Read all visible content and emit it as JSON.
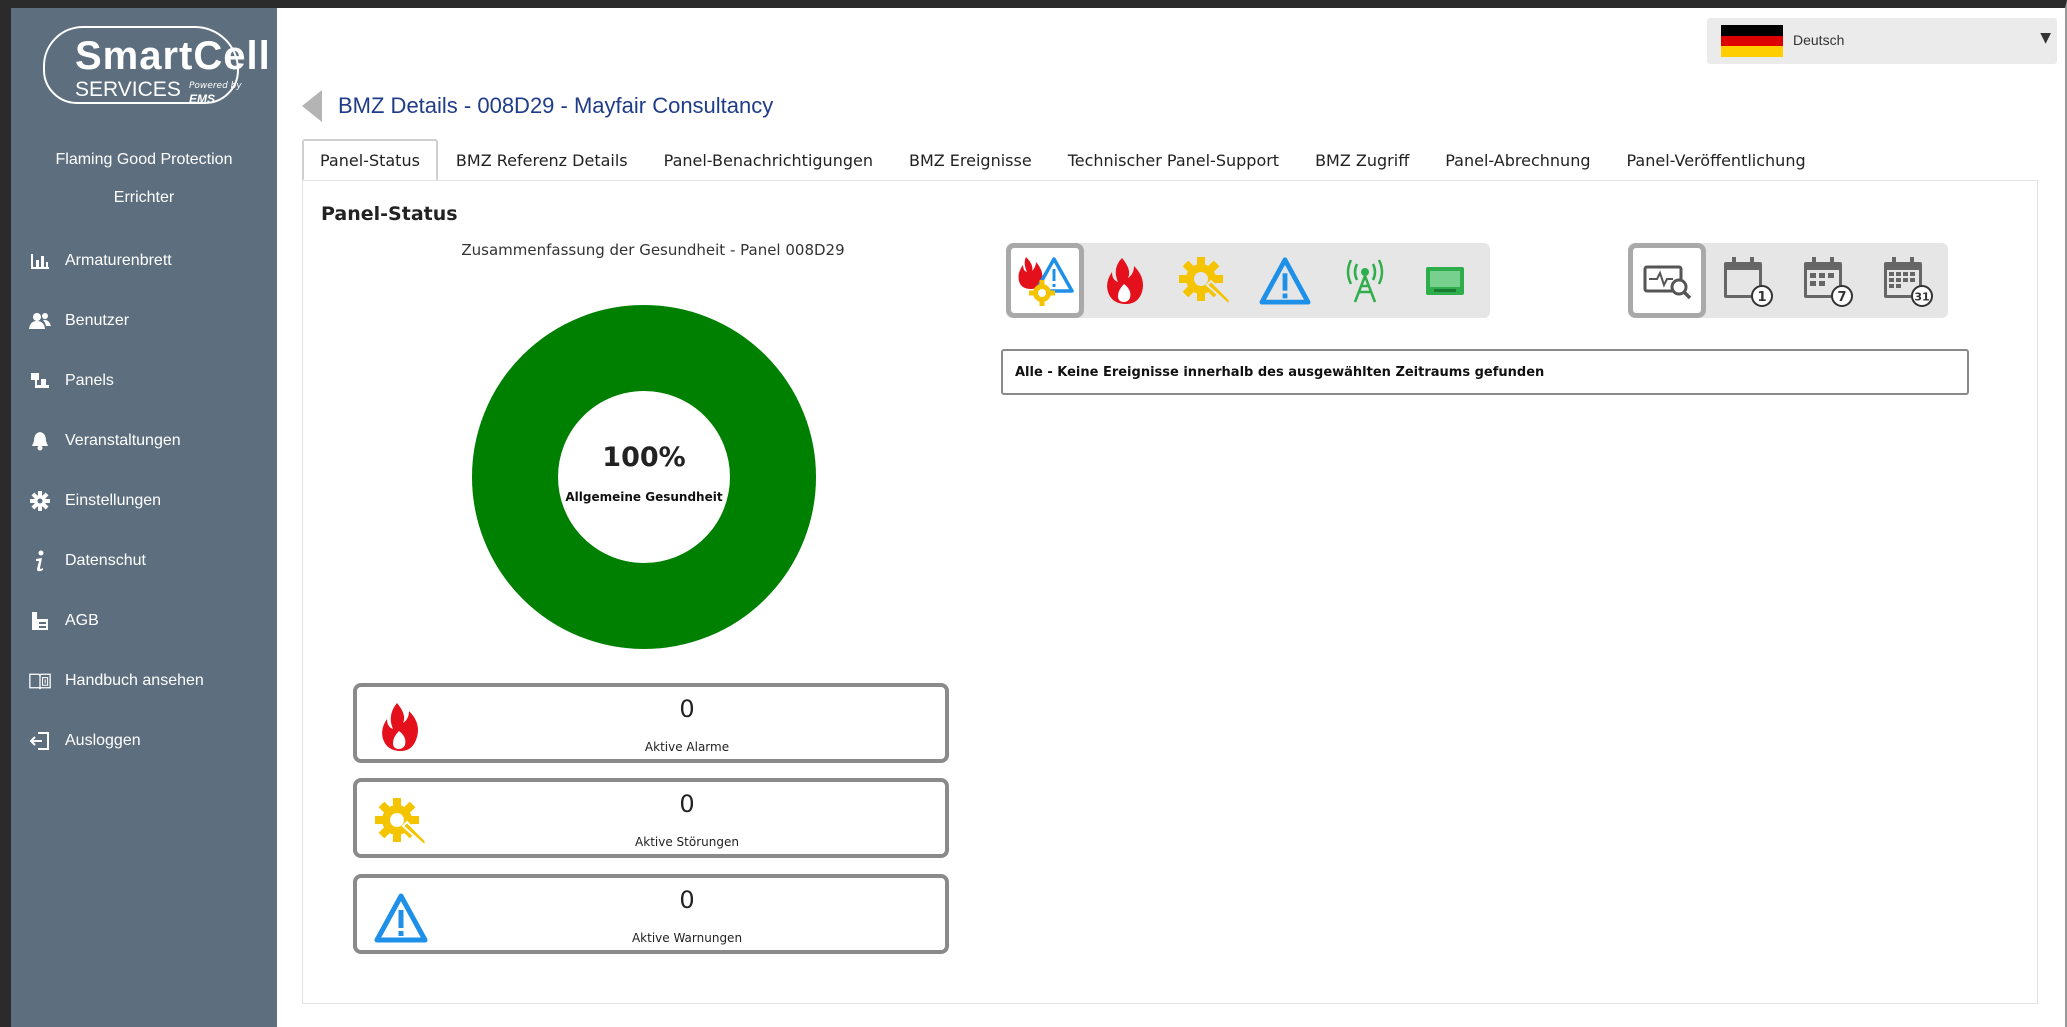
{
  "brand": {
    "logo_smart": "SmartCell",
    "logo_services": "SERVICES",
    "logo_powered": "Powered by",
    "logo_ems": "EMS"
  },
  "sidebar": {
    "company": "Flaming Good Protection",
    "role": "Errichter",
    "items": [
      {
        "label": "Armaturenbrett",
        "icon": "bar-chart-icon"
      },
      {
        "label": "Benutzer",
        "icon": "users-icon"
      },
      {
        "label": "Panels",
        "icon": "panels-icon"
      },
      {
        "label": "Veranstaltungen",
        "icon": "bell-icon"
      },
      {
        "label": "Einstellungen",
        "icon": "gear-icon"
      },
      {
        "label": "Datenschut",
        "icon": "info-icon"
      },
      {
        "label": "AGB",
        "icon": "document-icon"
      },
      {
        "label": "Handbuch ansehen",
        "icon": "book-icon"
      },
      {
        "label": "Ausloggen",
        "icon": "logout-icon"
      }
    ]
  },
  "language": {
    "selected": "Deutsch",
    "flag": "de-flag-icon"
  },
  "header": {
    "title": "BMZ Details - 008D29 - Mayfair Consultancy"
  },
  "tabs": [
    {
      "label": "Panel-Status",
      "active": true
    },
    {
      "label": "BMZ Referenz Details",
      "active": false
    },
    {
      "label": "Panel-Benachrichtigungen",
      "active": false
    },
    {
      "label": "BMZ Ereignisse",
      "active": false
    },
    {
      "label": "Technischer Panel-Support",
      "active": false
    },
    {
      "label": "BMZ Zugriff",
      "active": false
    },
    {
      "label": "Panel-Abrechnung",
      "active": false
    },
    {
      "label": "Panel-Veröffentlichung",
      "active": false
    }
  ],
  "panel": {
    "heading": "Panel-Status",
    "health_caption": "Zusammenfassung der Gesundheit - Panel 008D29",
    "health_percent": "100%",
    "health_value": 100,
    "health_label": "Allgemeine Gesundheit",
    "health_color": "#008000",
    "cards": [
      {
        "value": "0",
        "label": "Aktive Alarme",
        "icon": "fire-icon"
      },
      {
        "value": "0",
        "label": "Aktive Störungen",
        "icon": "fault-gear-icon"
      },
      {
        "value": "0",
        "label": "Aktive Warnungen",
        "icon": "warning-icon"
      }
    ],
    "event_filters": [
      "all-events-icon",
      "fire-icon",
      "fault-gear-icon",
      "warning-icon",
      "signal-tower-icon",
      "network-card-icon"
    ],
    "time_filters": [
      "monitor-search-icon",
      "calendar-1-day-icon",
      "calendar-7-days-icon",
      "calendar-31-days-icon"
    ],
    "event_message": "Alle - Keine Ereignisse innerhalb des ausgewählten Zeitraums gefunden"
  },
  "colors": {
    "sidebar_bg": "#5d6e7e",
    "fire": "#e4101b",
    "fault": "#f5c400",
    "warning": "#1e90e8",
    "title": "#1f3c88"
  }
}
